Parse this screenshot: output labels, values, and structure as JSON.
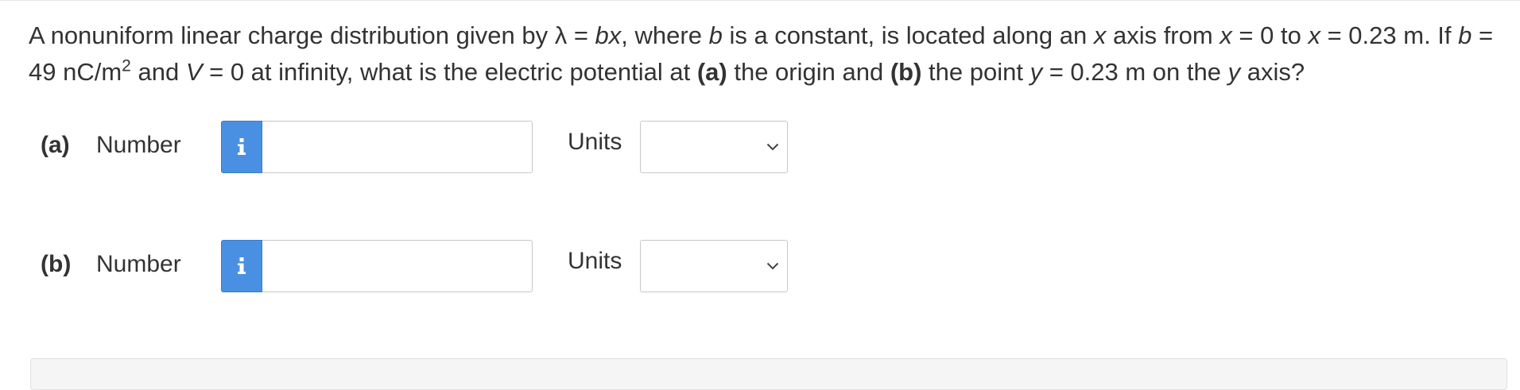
{
  "question": {
    "seg1": "A nonuniform linear charge distribution given by λ = ",
    "bx": "bx",
    "seg2": ", where ",
    "b1": "b",
    "seg3": " is a constant, is located along an ",
    "x1": "x",
    "seg4": " axis from ",
    "x2": "x",
    "seg5": " = 0 to ",
    "x3": "x",
    "seg6": " = 0.23 m. If ",
    "b2": "b",
    "seg7": " = 49 nC/m",
    "exp": "2",
    "seg8": " and ",
    "v": "V",
    "seg9": " = 0 at infinity, what is the electric potential at ",
    "part_a": "(a)",
    "seg10": " the origin and ",
    "part_b": "(b)",
    "seg11": " the point ",
    "y1": "y",
    "seg12": " = 0.23 m on the ",
    "y2": "y",
    "seg13": " axis?"
  },
  "answers": [
    {
      "part": "(a)",
      "number_label": "Number",
      "info_icon": "info-icon",
      "value": "",
      "placeholder": "",
      "units_label": "Units",
      "units_selected": ""
    },
    {
      "part": "(b)",
      "number_label": "Number",
      "info_icon": "info-icon",
      "value": "",
      "placeholder": "",
      "units_label": "Units",
      "units_selected": ""
    }
  ],
  "colors": {
    "info_button": "#4a90e2",
    "text": "#333333",
    "input_border": "#c8c8c8",
    "panel_background": "#f5f5f5"
  }
}
